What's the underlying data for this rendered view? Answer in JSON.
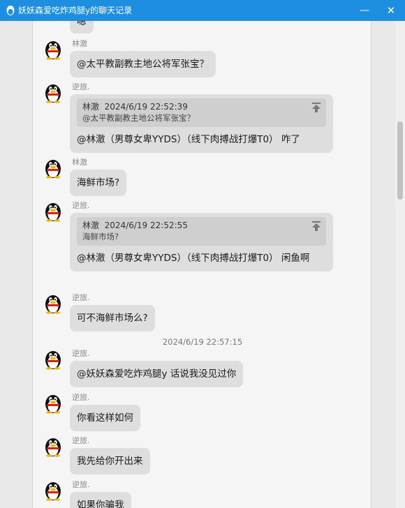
{
  "window": {
    "title": "妖妖森爱吃炸鸡腿y的聊天记录",
    "minimize_glyph": "—",
    "close_glyph": "✕",
    "app_icon": "qq-penguin-icon",
    "title_bar_color": "#1e8fe0"
  },
  "top_cut_text": "嗯",
  "messages": [
    {
      "sender": "林澈",
      "text": "@太平教副教主地公将军张宝？"
    },
    {
      "sender": "逆旅.",
      "quote": {
        "author": "林澈",
        "time": "2024/6/19 22:52:39",
        "text": "@太平教副教主地公将军张宝？"
      },
      "text": "@林澈（男尊女卑YYDS）（线下肉搏战打爆T0） 咋了"
    },
    {
      "sender": "林澈",
      "text": "海鲜市场?"
    },
    {
      "sender": "逆旅.",
      "quote": {
        "author": "林澈",
        "time": "2024/6/19 22:52:55",
        "text": "海鲜市场?"
      },
      "text": "@林澈（男尊女卑YYDS）（线下肉搏战打爆T0） 闲鱼啊"
    },
    {
      "sender": "逆旅.",
      "text": "可不海鲜市场么?"
    },
    {
      "sender": "逆旅.",
      "text": "@妖妖森爱吃炸鸡腿y 话说我没见过你"
    },
    {
      "sender": "逆旅.",
      "text": "你看这样如何"
    },
    {
      "sender": "逆旅.",
      "text": "我先给你开出来"
    },
    {
      "sender": "逆旅.",
      "text": "如果你骗我"
    }
  ],
  "timestamp": "2024/6/19 22:57:15",
  "avatar_icon": "qq-penguin-avatar-icon",
  "quote_jump_icon": "jump-to-top-arrow-icon"
}
